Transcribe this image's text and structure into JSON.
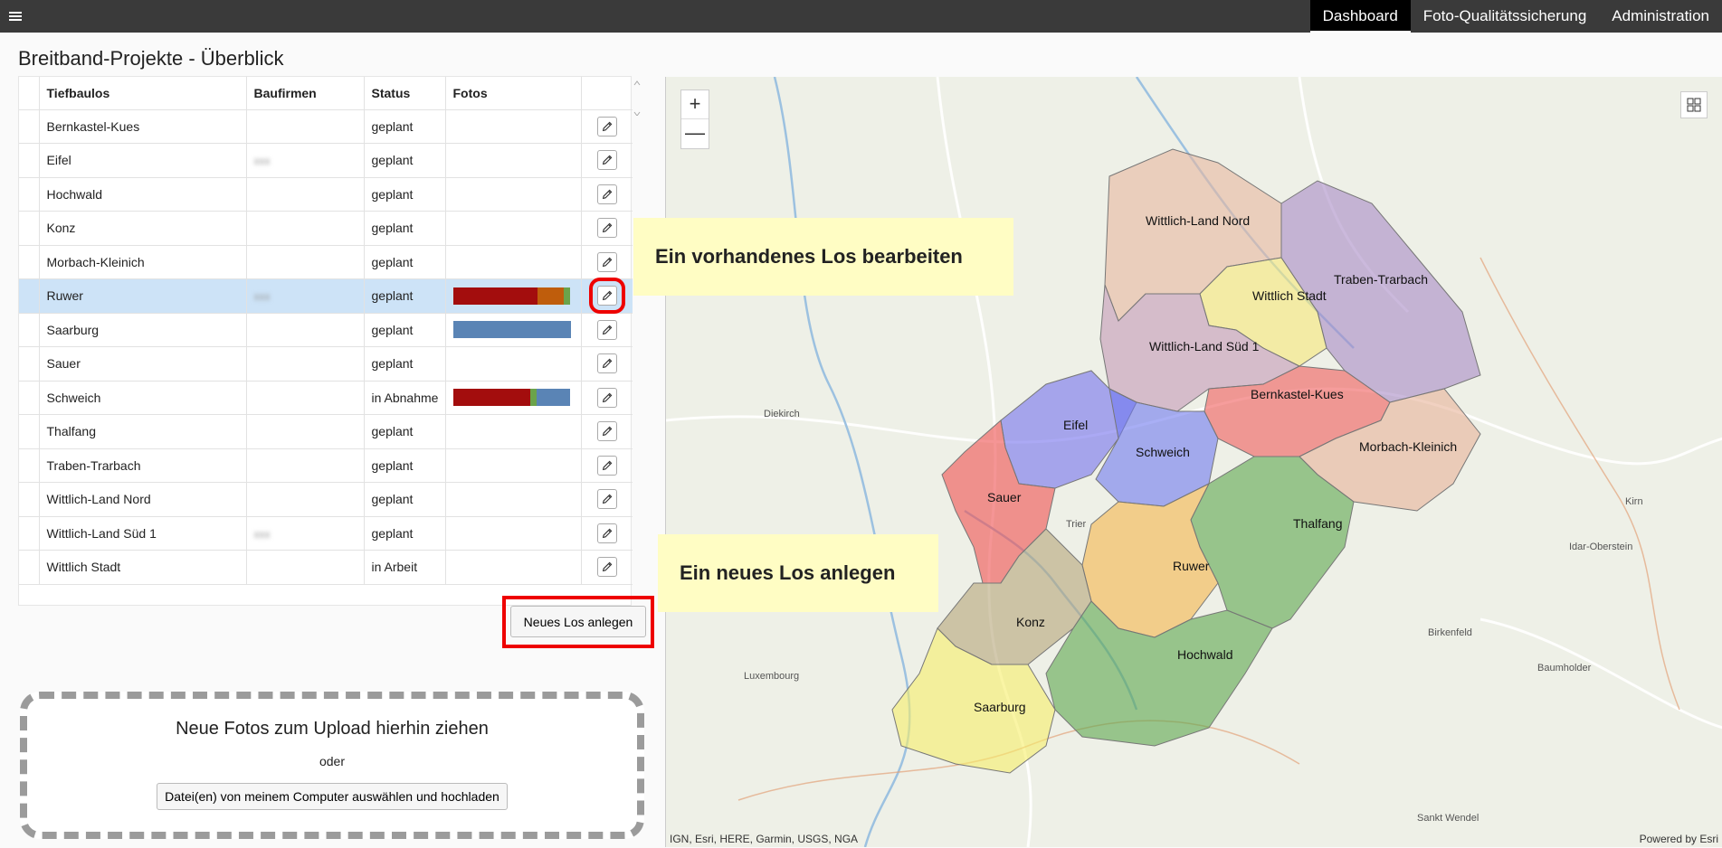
{
  "nav": {
    "menu_icon": "hamburger-icon",
    "items": [
      {
        "label": "Dashboard",
        "active": true
      },
      {
        "label": "Foto-Qualitätssicherung",
        "active": false
      },
      {
        "label": "Administration",
        "active": false
      }
    ]
  },
  "page": {
    "title": "Breitband-Projekte - Überblick"
  },
  "table": {
    "headers": [
      "Tiefbaulos",
      "Baufirmen",
      "Status",
      "Fotos"
    ],
    "rows": [
      {
        "name": "Bernkastel-Kues",
        "company": "",
        "status": "geplant"
      },
      {
        "name": "Eifel",
        "company": "xxx",
        "status": "geplant"
      },
      {
        "name": "Hochwald",
        "company": "",
        "status": "geplant"
      },
      {
        "name": "Konz",
        "company": "",
        "status": "geplant"
      },
      {
        "name": "Morbach-Kleinich",
        "company": "",
        "status": "geplant"
      },
      {
        "name": "Ruwer",
        "company": "xxx",
        "status": "geplant"
      },
      {
        "name": "Saarburg",
        "company": "",
        "status": "geplant"
      },
      {
        "name": "Sauer",
        "company": "",
        "status": "geplant"
      },
      {
        "name": "Schweich",
        "company": "",
        "status": "in Abnahme"
      },
      {
        "name": "Thalfang",
        "company": "",
        "status": "geplant"
      },
      {
        "name": "Traben-Trarbach",
        "company": "",
        "status": "geplant"
      },
      {
        "name": "Wittlich-Land Nord",
        "company": "",
        "status": "geplant"
      },
      {
        "name": "Wittlich-Land Süd 1",
        "company": "xxx",
        "status": "geplant"
      },
      {
        "name": "Wittlich Stadt",
        "company": "",
        "status": "in Arbeit"
      }
    ],
    "photo_bars": {
      "Ruwer": [
        {
          "color": "#a30d0d",
          "share": 0.72
        },
        {
          "color": "#bf5d0c",
          "share": 0.22
        },
        {
          "color": "#6ba34a",
          "share": 0.06
        }
      ],
      "Saarburg": [
        {
          "color": "#5a84b5",
          "share": 1.0
        }
      ],
      "Schweich": [
        {
          "color": "#a30d0d",
          "share": 0.66
        },
        {
          "color": "#6ba34a",
          "share": 0.05
        },
        {
          "color": "#5a84b5",
          "share": 0.29
        }
      ]
    },
    "edit_icon": "pencil-icon"
  },
  "buttons": {
    "new_los": "Neues Los anlegen"
  },
  "dropzone": {
    "title": "Neue Fotos zum Upload hierhin ziehen",
    "or": "oder",
    "upload_button": "Datei(en) von meinem Computer auswählen und hochladen"
  },
  "callouts": {
    "edit": "Ein vorhandenes Los bearbeiten",
    "new": "Ein neues Los anlegen"
  },
  "map": {
    "zoom_in": "+",
    "zoom_out": "—",
    "attribution": "IGN, Esri, HERE, Garmin, USGS, NGA",
    "powered": "Powered by Esri",
    "regions": [
      "Wittlich-Land Nord",
      "Traben-Trarbach",
      "Wittlich Stadt",
      "Wittlich-Land Süd 1",
      "Bernkastel-Kues",
      "Eifel",
      "Schweich",
      "Morbach-Kleinich",
      "Sauer",
      "Thalfang",
      "Ruwer",
      "Konz",
      "Hochwald",
      "Saarburg"
    ],
    "places": [
      "Luxembourg",
      "Diekirch",
      "Trier",
      "Kirn",
      "Idar-Oberstein",
      "Birkenfeld",
      "Baumholder",
      "Sankt Wendel"
    ]
  }
}
